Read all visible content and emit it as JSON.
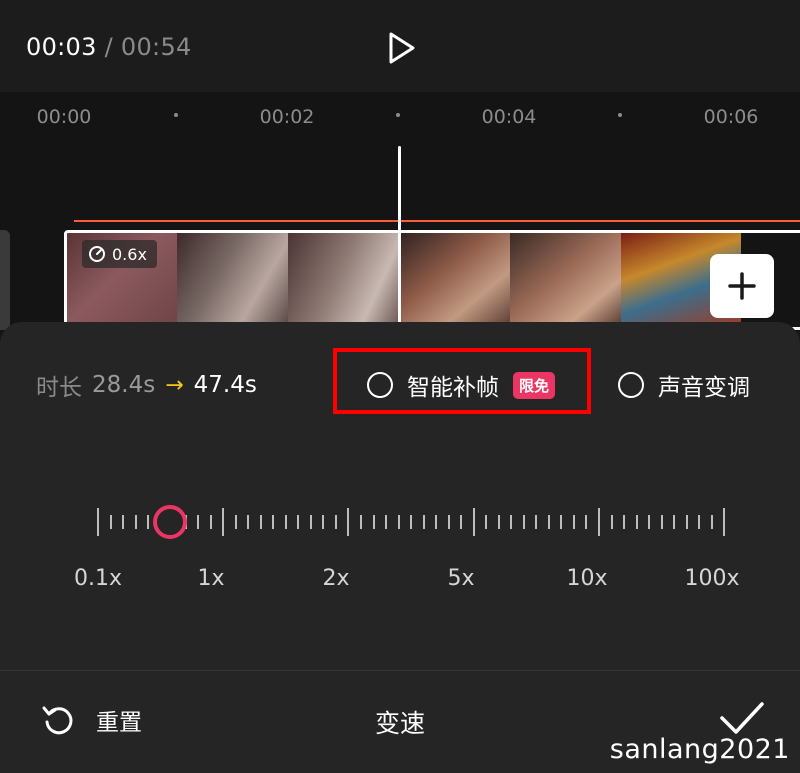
{
  "header": {
    "current_time": "00:03",
    "separator": " / ",
    "total_time": "00:54"
  },
  "ruler": {
    "labels": [
      "00:00",
      "00:02",
      "00:04",
      "00:06"
    ]
  },
  "clip": {
    "speed_badge": "0.6x"
  },
  "panel": {
    "duration_label": "时长",
    "duration_before": "28.4s",
    "duration_arrow": "→",
    "duration_after": "47.4s",
    "options": {
      "smart_interp_label": "智能补帧",
      "smart_interp_badge": "限免",
      "pitch_label": "声音变调"
    },
    "speed_scale": [
      "0.1x",
      "1x",
      "2x",
      "5x",
      "10x",
      "100x"
    ],
    "current_speed": "0.6x"
  },
  "footer": {
    "reset_label": "重置",
    "title": "变速"
  },
  "watermark": "sanlang2021",
  "colors": {
    "accent_pink": "#ea3565",
    "arrow_yellow": "#f7c91b",
    "timeline_orange": "#ff5a3c",
    "highlight_red": "#ff0000"
  },
  "icons": [
    "play-icon",
    "speed-gauge-icon",
    "plus-icon",
    "reset-icon",
    "checkmark-icon"
  ]
}
